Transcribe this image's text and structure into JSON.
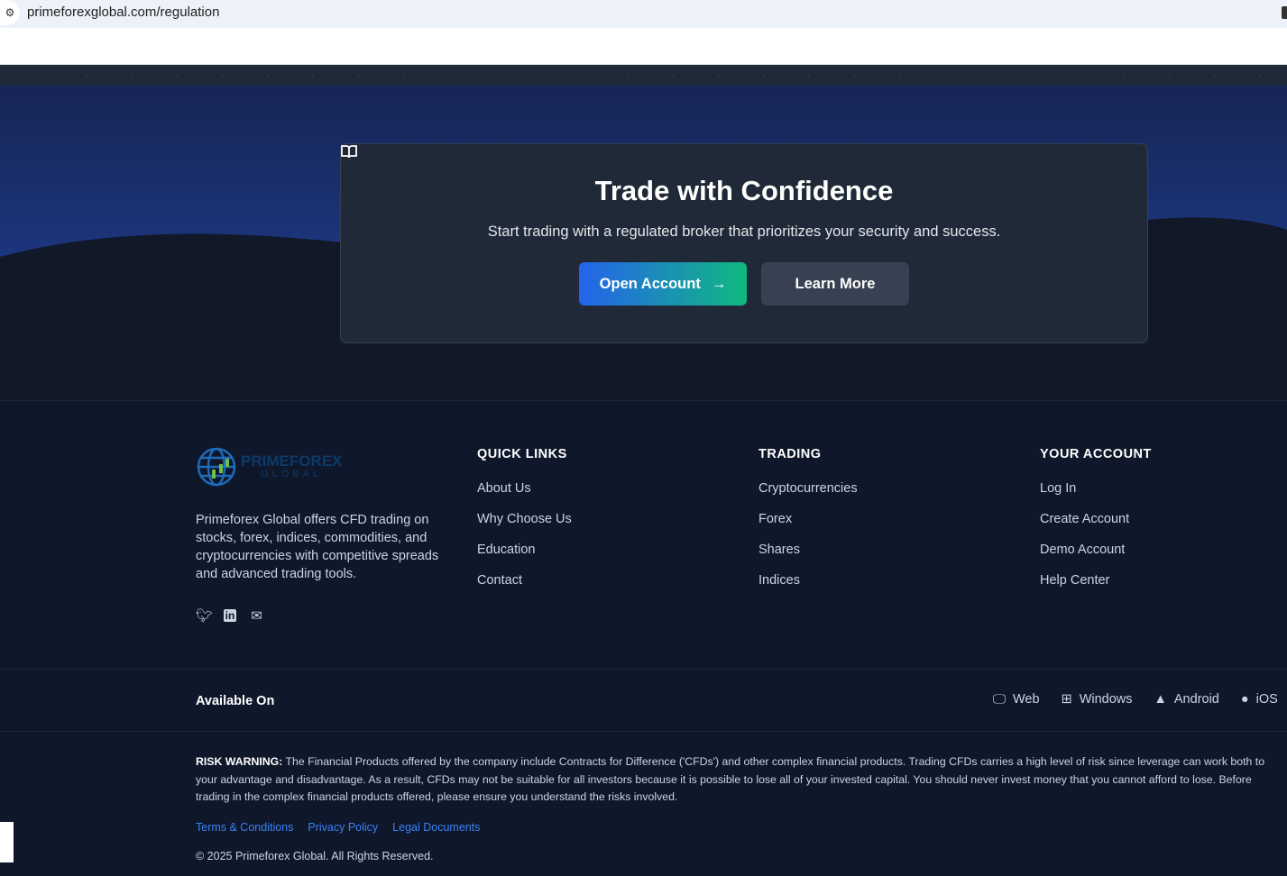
{
  "browser": {
    "url": "primeforexglobal.com/regulation"
  },
  "cta": {
    "title": "Trade with Confidence",
    "subtitle": "Start trading with a regulated broker that prioritizes your security and success.",
    "open_account": "Open Account",
    "learn_more": "Learn More"
  },
  "footer": {
    "logo": {
      "line1": "PRIMEFOREX",
      "line2": "GLOBAL"
    },
    "description": "Primeforex Global offers CFD trading on stocks, forex, indices, commodities, and cryptocurrencies with competitive spreads and advanced trading tools.",
    "quick_links": {
      "title": "QUICK LINKS",
      "items": [
        "About Us",
        "Why Choose Us",
        "Education",
        "Contact"
      ]
    },
    "trading": {
      "title": "TRADING",
      "items": [
        "Cryptocurrencies",
        "Forex",
        "Shares",
        "Indices"
      ]
    },
    "account": {
      "title": "YOUR ACCOUNT",
      "items": [
        "Log In",
        "Create Account",
        "Demo Account",
        "Help Center"
      ]
    },
    "available": {
      "label": "Available On",
      "platforms": [
        "Web",
        "Windows",
        "Android",
        "iOS"
      ]
    },
    "risk": {
      "label": "RISK WARNING:",
      "text": " The Financial Products offered by the company include Contracts for Difference ('CFDs') and other complex financial products. Trading CFDs carries a high level of risk since leverage can work both to your advantage and disadvantage. As a result, CFDs may not be suitable for all investors because it is possible to lose all of your invested capital. You should never invest money that you cannot afford to lose. Before trading in the complex financial products offered, please ensure you understand the risks involved."
    },
    "legal_links": [
      "Terms & Conditions",
      "Privacy Policy",
      "Legal Documents"
    ],
    "copyright": "© 2025 Primeforex Global. All Rights Reserved."
  }
}
